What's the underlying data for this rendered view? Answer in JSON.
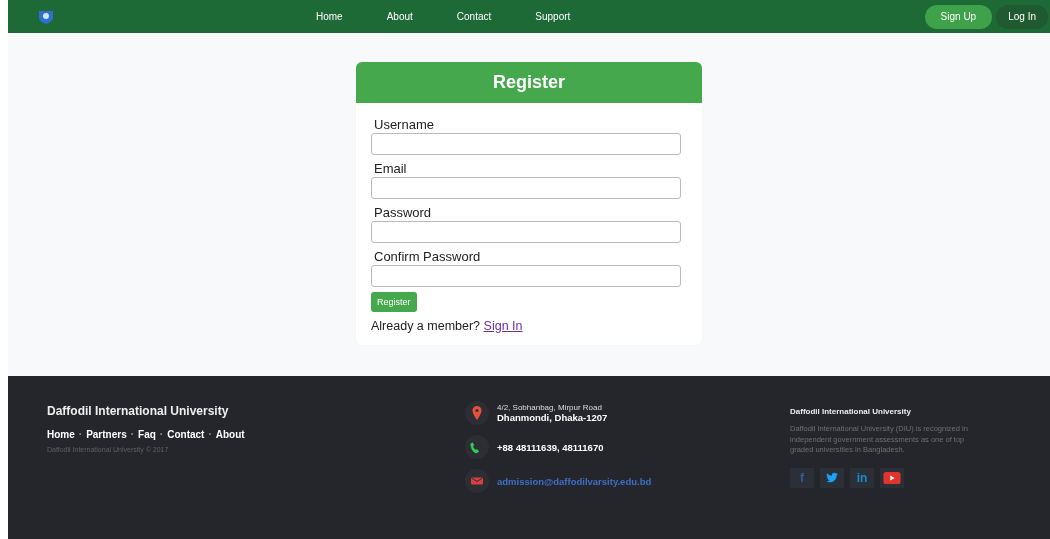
{
  "navbar": {
    "links": [
      {
        "label": "Home"
      },
      {
        "label": "About"
      },
      {
        "label": "Contact"
      },
      {
        "label": "Support"
      }
    ],
    "actions": [
      {
        "label": "Sign Up",
        "selected": true
      },
      {
        "label": "Log In",
        "selected": false
      }
    ]
  },
  "register": {
    "title": "Register",
    "fields": [
      {
        "label": "Username"
      },
      {
        "label": "Email"
      },
      {
        "label": "Password"
      },
      {
        "label": "Confirm Password"
      }
    ],
    "submit": "Register",
    "prompt": "Already a member?",
    "link": "Sign In"
  },
  "footer": {
    "brand": "Daffodil International University",
    "separator": "·",
    "links": [
      "Home",
      "Partners",
      "Faq",
      "Contact",
      "About"
    ],
    "copyright": "Daffodil International University © 2017",
    "contacts": [
      {
        "kind": "location",
        "lines": [
          "4/2, Sobhanbag, Mirpur Road",
          "Dhanmondi, Dhaka-1207"
        ]
      },
      {
        "kind": "phone",
        "lines": [
          "+88 48111639, 48111670"
        ]
      },
      {
        "kind": "email",
        "lines": [
          "admission@daffodilvarsity.edu.bd"
        ]
      }
    ],
    "about_title": "Daffodil International University",
    "about_text": "Daffodil International University (DIU) is recognized in independent government assessments as one of top graded universities in Bangladesh.",
    "social": [
      {
        "kind": "facebook",
        "glyph": "f"
      },
      {
        "kind": "twitter"
      },
      {
        "kind": "linkedin",
        "glyph": "in"
      },
      {
        "kind": "youtube"
      }
    ]
  }
}
